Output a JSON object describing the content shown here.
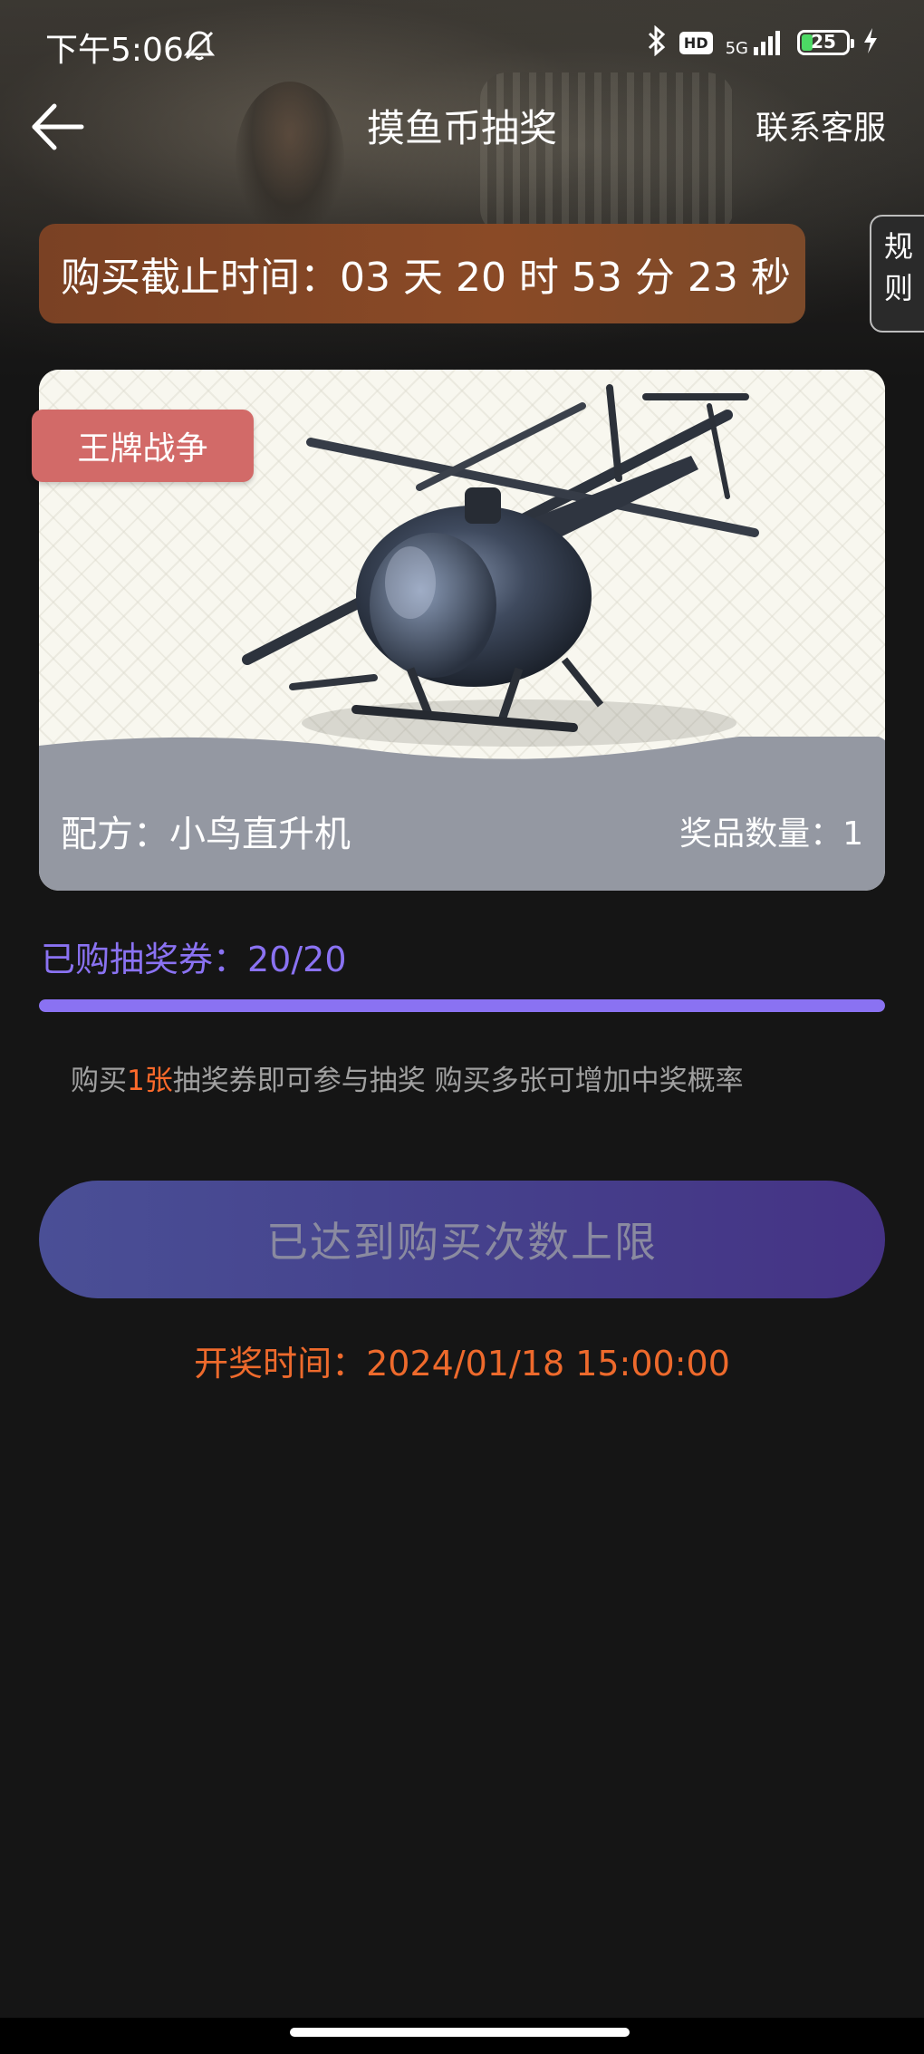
{
  "status_bar": {
    "time": "下午5:06",
    "icons": [
      "bell-off-icon",
      "bluetooth-icon",
      "hd-icon",
      "5g-signal-icon",
      "battery-icon",
      "charging-icon"
    ],
    "hd_label": "HD",
    "network_label": "5G",
    "battery_level": "25",
    "battery_fraction": 0.25
  },
  "nav": {
    "title": "摸鱼币抽奖",
    "contact": "联系客服"
  },
  "countdown": {
    "text": "购买截止时间：03 天 20 时 53 分 23 秒"
  },
  "rules_tab": {
    "line1": "规",
    "line2": "则"
  },
  "prize": {
    "tag": "王牌战争",
    "recipe": "配方：小鸟直升机",
    "quantity": "奖品数量：1",
    "image": "helicopter"
  },
  "progress": {
    "label": "已购抽奖券：20/20",
    "fraction": 1.0
  },
  "hint": {
    "before": "购买",
    "accent": "1张",
    "after": "抽奖券即可参与抽奖 购买多张可增加中奖概率"
  },
  "button": {
    "label": "已达到购买次数上限"
  },
  "draw_time": {
    "text": "开奖时间：2024/01/18 15:00:00"
  },
  "colors": {
    "accent_purple": "#8a72f2",
    "accent_orange": "#ee6a2c",
    "countdown_bg": "#7a4124",
    "tag_bg": "#d26a68",
    "page_bg": "#151515"
  }
}
